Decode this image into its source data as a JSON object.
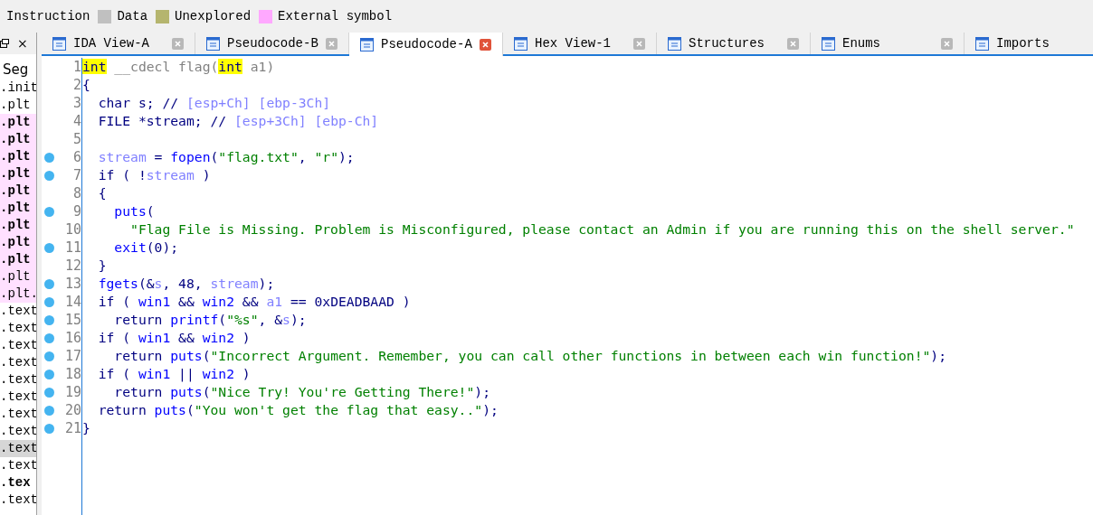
{
  "legend": [
    {
      "label": "Instruction"
    },
    {
      "label": "Data",
      "color": "#c0c0c0"
    },
    {
      "label": "Unexplored",
      "color": "#b5b56e"
    },
    {
      "label": "External symbol",
      "color": "#ffa8ff"
    }
  ],
  "side_pane": {
    "close": "×",
    "header": "Seg",
    "items": [
      {
        "label": ".init",
        "external": false,
        "bold": false,
        "selected": false
      },
      {
        "label": ".plt",
        "external": false,
        "bold": false,
        "selected": false
      },
      {
        "label": ".plt",
        "external": true,
        "bold": true,
        "selected": false
      },
      {
        "label": ".plt",
        "external": true,
        "bold": true,
        "selected": false
      },
      {
        "label": ".plt",
        "external": true,
        "bold": true,
        "selected": false
      },
      {
        "label": ".plt",
        "external": true,
        "bold": true,
        "selected": false
      },
      {
        "label": ".plt",
        "external": true,
        "bold": true,
        "selected": false
      },
      {
        "label": ".plt",
        "external": true,
        "bold": true,
        "selected": false
      },
      {
        "label": ".plt",
        "external": true,
        "bold": true,
        "selected": false
      },
      {
        "label": ".plt",
        "external": true,
        "bold": true,
        "selected": false
      },
      {
        "label": ".plt",
        "external": true,
        "bold": true,
        "selected": false
      },
      {
        "label": ".plt",
        "external": true,
        "bold": false,
        "selected": false
      },
      {
        "label": ".plt.",
        "external": true,
        "bold": false,
        "selected": false
      },
      {
        "label": ".text",
        "external": false,
        "bold": false,
        "selected": false
      },
      {
        "label": ".text",
        "external": false,
        "bold": false,
        "selected": false
      },
      {
        "label": ".text",
        "external": false,
        "bold": false,
        "selected": false
      },
      {
        "label": ".text",
        "external": false,
        "bold": false,
        "selected": false
      },
      {
        "label": ".text",
        "external": false,
        "bold": false,
        "selected": false
      },
      {
        "label": ".text",
        "external": false,
        "bold": false,
        "selected": false
      },
      {
        "label": ".text",
        "external": false,
        "bold": false,
        "selected": false
      },
      {
        "label": ".text",
        "external": false,
        "bold": false,
        "selected": false
      },
      {
        "label": ".text",
        "external": false,
        "bold": false,
        "selected": true
      },
      {
        "label": ".text",
        "external": false,
        "bold": false,
        "selected": false
      },
      {
        "label": ".tex",
        "external": false,
        "bold": true,
        "selected": false
      },
      {
        "label": ".text",
        "external": false,
        "bold": false,
        "selected": false
      }
    ]
  },
  "tabs": [
    {
      "label": "IDA View-A",
      "selected": false
    },
    {
      "label": "Pseudocode-B",
      "selected": false
    },
    {
      "label": "Pseudocode-A",
      "selected": true
    },
    {
      "label": "Hex View-1",
      "selected": false
    },
    {
      "label": "Structures",
      "selected": false
    },
    {
      "label": "Enums",
      "selected": false
    },
    {
      "label": "Imports",
      "selected": false
    }
  ],
  "code_lines": [
    {
      "number": "1",
      "marked": false,
      "tokens": [
        {
          "text": "int",
          "kind": "keyword"
        },
        {
          "text": " __cdecl flag(",
          "kind": "dim"
        },
        {
          "text": "int",
          "kind": "keyword"
        },
        {
          "text": " a1)",
          "kind": "dim"
        }
      ]
    },
    {
      "number": "2",
      "marked": false,
      "tokens": [
        {
          "text": "{",
          "kind": "plain"
        }
      ]
    },
    {
      "number": "3",
      "marked": false,
      "tokens": [
        {
          "text": "  char s; // ",
          "kind": "plain"
        },
        {
          "text": "[esp+Ch] [ebp-3Ch]",
          "kind": "local"
        }
      ]
    },
    {
      "number": "4",
      "marked": false,
      "tokens": [
        {
          "text": "  FILE *stream; // ",
          "kind": "plain"
        },
        {
          "text": "[esp+3Ch] [ebp-Ch]",
          "kind": "local"
        }
      ]
    },
    {
      "number": "5",
      "marked": false
    },
    {
      "number": "6",
      "marked": true,
      "tokens": [
        {
          "text": "  stream",
          "kind": "local"
        },
        {
          "text": " = ",
          "kind": "plain"
        },
        {
          "text": "fopen",
          "kind": "func"
        },
        {
          "text": "(",
          "kind": "plain"
        },
        {
          "text": "\"flag.txt\"",
          "kind": "string"
        },
        {
          "text": ", ",
          "kind": "plain"
        },
        {
          "text": "\"r\"",
          "kind": "string"
        },
        {
          "text": ");",
          "kind": "plain"
        }
      ]
    },
    {
      "number": "7",
      "marked": true,
      "tokens": [
        {
          "text": "  if ( !",
          "kind": "plain"
        },
        {
          "text": "stream",
          "kind": "local"
        },
        {
          "text": " )",
          "kind": "plain"
        }
      ]
    },
    {
      "number": "8",
      "marked": false,
      "tokens": [
        {
          "text": "  {",
          "kind": "plain"
        }
      ]
    },
    {
      "number": "9",
      "marked": true,
      "tokens": [
        {
          "text": "    puts",
          "kind": "func"
        },
        {
          "text": "(",
          "kind": "plain"
        }
      ]
    },
    {
      "number": "10",
      "marked": false,
      "tokens": [
        {
          "text": "      \"Flag File is Missing. Problem is Misconfigured, please contact an Admin if you are running this on the shell server.\"",
          "kind": "string"
        }
      ]
    },
    {
      "number": "11",
      "marked": true,
      "tokens": [
        {
          "text": "    exit",
          "kind": "func"
        },
        {
          "text": "(0);",
          "kind": "plain"
        }
      ]
    },
    {
      "number": "12",
      "marked": false,
      "tokens": [
        {
          "text": "  }",
          "kind": "plain"
        }
      ]
    },
    {
      "number": "13",
      "marked": true,
      "tokens": [
        {
          "text": "  fgets",
          "kind": "func"
        },
        {
          "text": "(&",
          "kind": "plain"
        },
        {
          "text": "s",
          "kind": "local"
        },
        {
          "text": ", 48, ",
          "kind": "plain"
        },
        {
          "text": "stream",
          "kind": "local"
        },
        {
          "text": ");",
          "kind": "plain"
        }
      ]
    },
    {
      "number": "14",
      "marked": true,
      "tokens": [
        {
          "text": "  if ( ",
          "kind": "plain"
        },
        {
          "text": "win1",
          "kind": "func"
        },
        {
          "text": " && ",
          "kind": "plain"
        },
        {
          "text": "win2",
          "kind": "func"
        },
        {
          "text": " && ",
          "kind": "plain"
        },
        {
          "text": "a1",
          "kind": "local"
        },
        {
          "text": " == 0xDEADBAAD )",
          "kind": "plain"
        }
      ]
    },
    {
      "number": "15",
      "marked": true,
      "tokens": [
        {
          "text": "    return ",
          "kind": "plain"
        },
        {
          "text": "printf",
          "kind": "func"
        },
        {
          "text": "(",
          "kind": "plain"
        },
        {
          "text": "\"%s\"",
          "kind": "string"
        },
        {
          "text": ", &",
          "kind": "plain"
        },
        {
          "text": "s",
          "kind": "local"
        },
        {
          "text": ");",
          "kind": "plain"
        }
      ]
    },
    {
      "number": "16",
      "marked": true,
      "tokens": [
        {
          "text": "  if ( ",
          "kind": "plain"
        },
        {
          "text": "win1",
          "kind": "func"
        },
        {
          "text": " && ",
          "kind": "plain"
        },
        {
          "text": "win2",
          "kind": "func"
        },
        {
          "text": " )",
          "kind": "plain"
        }
      ]
    },
    {
      "number": "17",
      "marked": true,
      "tokens": [
        {
          "text": "    return ",
          "kind": "plain"
        },
        {
          "text": "puts",
          "kind": "func"
        },
        {
          "text": "(",
          "kind": "plain"
        },
        {
          "text": "\"Incorrect Argument. Remember, you can call other functions in between each win function!\"",
          "kind": "string"
        },
        {
          "text": ");",
          "kind": "plain"
        }
      ]
    },
    {
      "number": "18",
      "marked": true,
      "tokens": [
        {
          "text": "  if ( ",
          "kind": "plain"
        },
        {
          "text": "win1",
          "kind": "func"
        },
        {
          "text": " || ",
          "kind": "plain"
        },
        {
          "text": "win2",
          "kind": "func"
        },
        {
          "text": " )",
          "kind": "plain"
        }
      ]
    },
    {
      "number": "19",
      "marked": true,
      "tokens": [
        {
          "text": "    return ",
          "kind": "plain"
        },
        {
          "text": "puts",
          "kind": "func"
        },
        {
          "text": "(",
          "kind": "plain"
        },
        {
          "text": "\"Nice Try! You're Getting There!\"",
          "kind": "string"
        },
        {
          "text": ");",
          "kind": "plain"
        }
      ]
    },
    {
      "number": "20",
      "marked": true,
      "tokens": [
        {
          "text": "  return ",
          "kind": "plain"
        },
        {
          "text": "puts",
          "kind": "func"
        },
        {
          "text": "(",
          "kind": "plain"
        },
        {
          "text": "\"You won't get the flag that easy..\"",
          "kind": "string"
        },
        {
          "text": ");",
          "kind": "plain"
        }
      ]
    },
    {
      "number": "21",
      "marked": true,
      "tokens": [
        {
          "text": "}",
          "kind": "plain"
        }
      ]
    }
  ]
}
